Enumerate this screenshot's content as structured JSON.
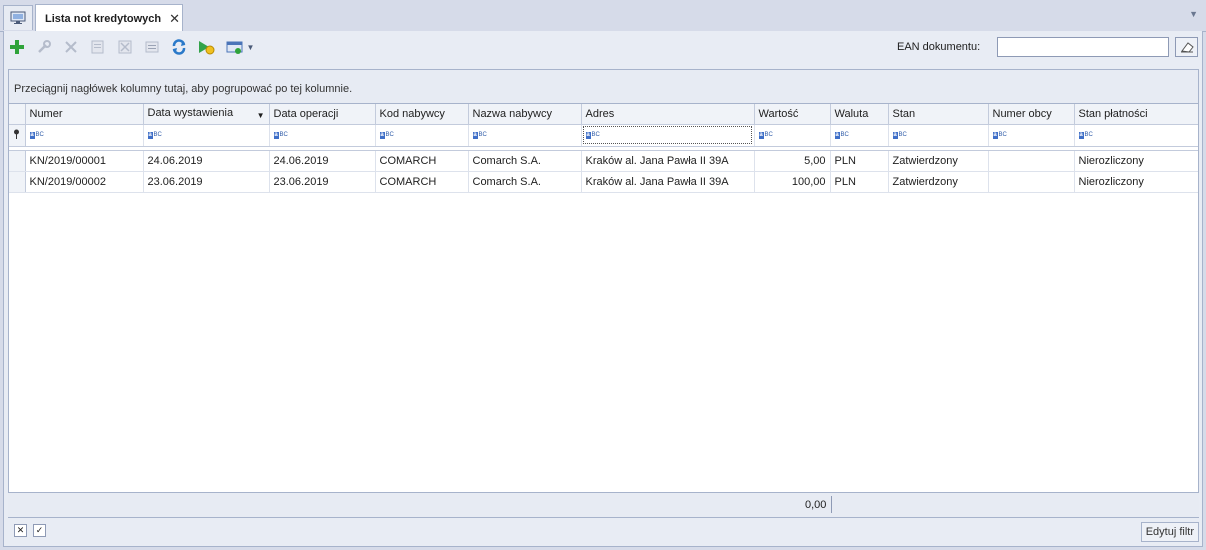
{
  "tab": {
    "title": "Lista not kredytowych",
    "close": "✕"
  },
  "toolbar": {
    "ean_label": "EAN dokumentu:",
    "ean_value": "",
    "colors": {
      "add": "#2fa33a",
      "refresh": "#2a79c9",
      "play": "#33a34a"
    }
  },
  "grid": {
    "group_hint": "Przeciągnij nagłówek kolumny tutaj, aby pogrupować po tej kolumnie.",
    "columns": [
      "Numer",
      "Data wystawienia",
      "Data operacji",
      "Kod nabywcy",
      "Nazwa nabywcy",
      "Adres",
      "Wartość",
      "Waluta",
      "Stan",
      "Numer obcy",
      "Stan płatności"
    ],
    "rows": [
      [
        "KN/2019/00001",
        "24.06.2019",
        "24.06.2019",
        "COMARCH",
        "Comarch S.A.",
        "Kraków al. Jana Pawła II 39A",
        "5,00",
        "PLN",
        "Zatwierdzony",
        "",
        "Nierozliczony"
      ],
      [
        "KN/2019/00002",
        "23.06.2019",
        "23.06.2019",
        "COMARCH",
        "Comarch S.A.",
        "Kraków al. Jana Pawła II 39A",
        "100,00",
        "PLN",
        "Zatwierdzony",
        "",
        "Nierozliczony"
      ]
    ],
    "total": "0,00"
  },
  "filter": {
    "edit_label": "Edytuj filtr"
  }
}
